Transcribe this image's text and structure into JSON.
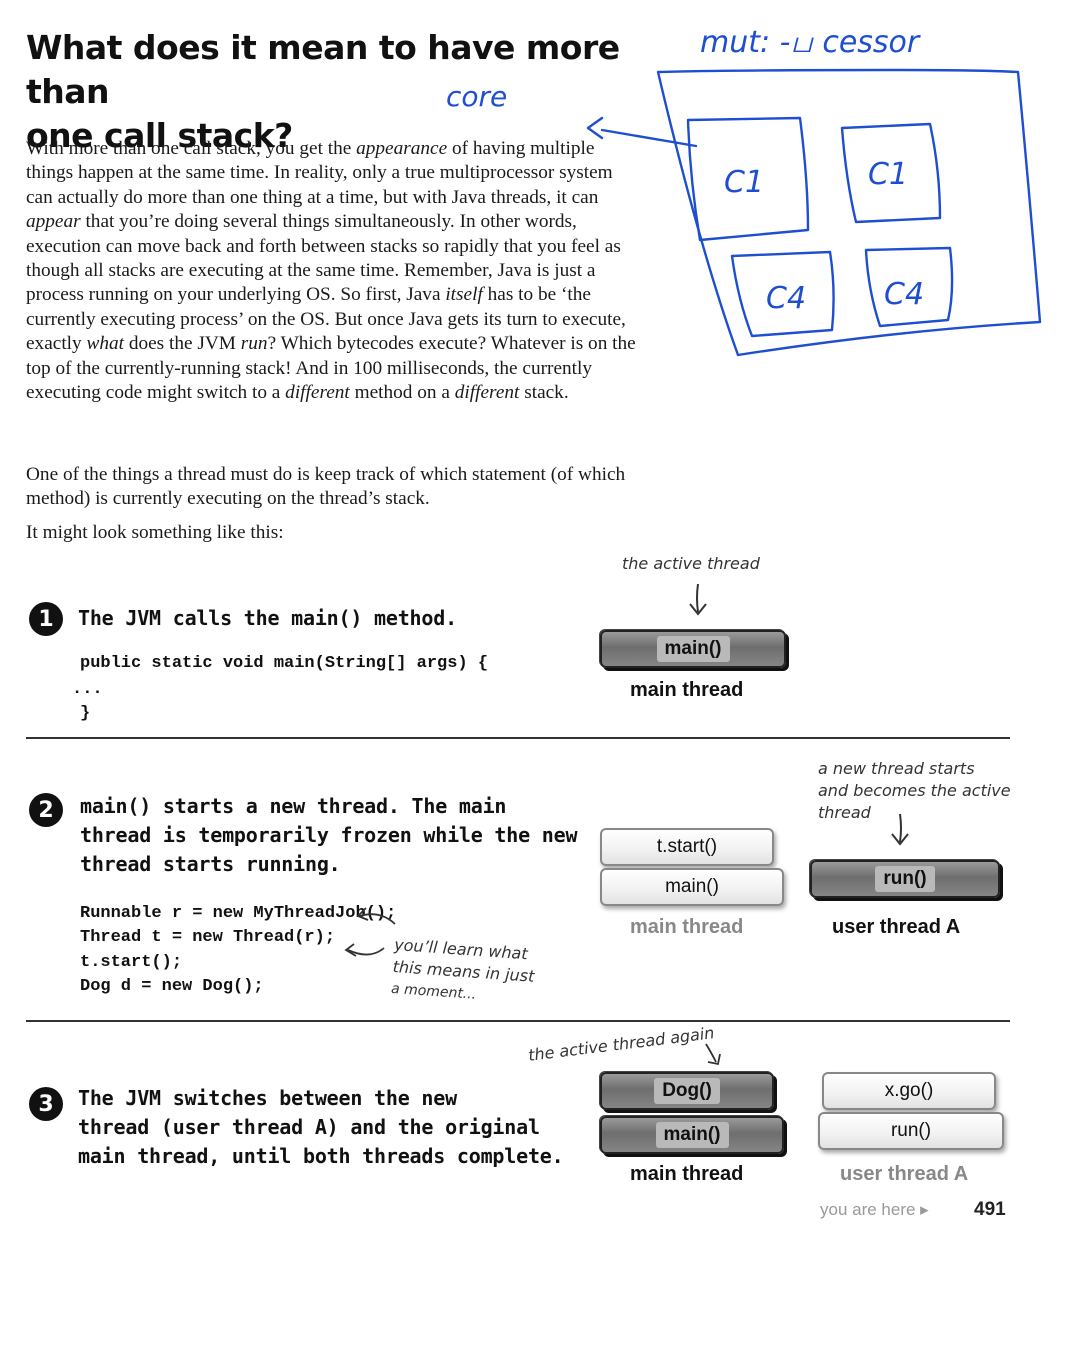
{
  "title": {
    "line1": "What does it mean to have more than",
    "line2": "one call stack?"
  },
  "annotations": {
    "top_scribble": "mut: -ப cessor",
    "core_note": "core",
    "box_c1_a": "C1",
    "box_c1_b": "C1",
    "box_c4_a": "C4",
    "box_c4_b": "C4"
  },
  "paragraphs": {
    "p1_a": "With more than one call stack, you get the ",
    "p1_appearance": "appearance",
    "p1_b": " of having multiple things happen at the same time. In reality, only a true multiprocessor system can actually do more than one thing at a time, but with Java threads, it can ",
    "p1_appear": "appear",
    "p1_c": " that you’re doing several things simultaneously. In other words, execution can move back and forth between stacks so rapidly that you feel as though all stacks are executing at the same time. Remember, Java is just a process running on your underlying OS. So first, Java ",
    "p1_itself": "itself",
    "p1_d": " has to be ‘the currently executing process’ on the OS. But once Java gets its turn to execute, exactly ",
    "p1_what": "what",
    "p1_e": " does the JVM ",
    "p1_run": "run",
    "p1_f": "? Which bytecodes execute?  Whatever is on the top of the currently-running stack! And in 100 milliseconds, the currently executing code might switch to a ",
    "p1_different1": "different",
    "p1_g": " method on a ",
    "p1_different2": "different",
    "p1_h": " stack.",
    "p2": "One of the things a thread must do is keep track of which statement (of which method) is currently executing on the thread’s stack.",
    "p3": "It might look something like this:"
  },
  "step1": {
    "number": "1",
    "heading": "The JVM calls the main() method.",
    "code": [
      "public static void main(String[] args) {",
      "...",
      "}"
    ],
    "active_note": "the active thread",
    "stack_frame": "main()",
    "stack_label": "main thread"
  },
  "step2": {
    "number": "2",
    "heading_lines": [
      "main() starts a new thread. The main",
      "thread is temporarily frozen while the new",
      "thread starts running."
    ],
    "code": [
      "Runnable r = new MyThreadJob();",
      "Thread t = new Thread(r);",
      "t.start();",
      "Dog d = new Dog();"
    ],
    "learn_note_lines": [
      "you’ll learn what",
      "this means in just",
      "a moment..."
    ],
    "main_frames": [
      "t.start()",
      "main()"
    ],
    "main_label": "main thread",
    "new_note_lines": [
      "a new thread starts",
      "and becomes the active",
      "thread"
    ],
    "user_frame": "run()",
    "user_label": "user thread A"
  },
  "step3": {
    "number": "3",
    "heading_lines": [
      "The JVM switches between the new",
      "thread (user thread A) and the original",
      "main thread, until both threads complete."
    ],
    "active_note": "the active thread again",
    "main_frames": [
      "Dog()",
      "main()"
    ],
    "main_label": "main thread",
    "user_frames": [
      "x.go()",
      "run()"
    ],
    "user_label": "user thread A"
  },
  "footer": {
    "you_are_here": "you are here ▸",
    "page_number": "491"
  },
  "colors": {
    "ink_blue": "#1f4fd1",
    "text": "#111111"
  }
}
